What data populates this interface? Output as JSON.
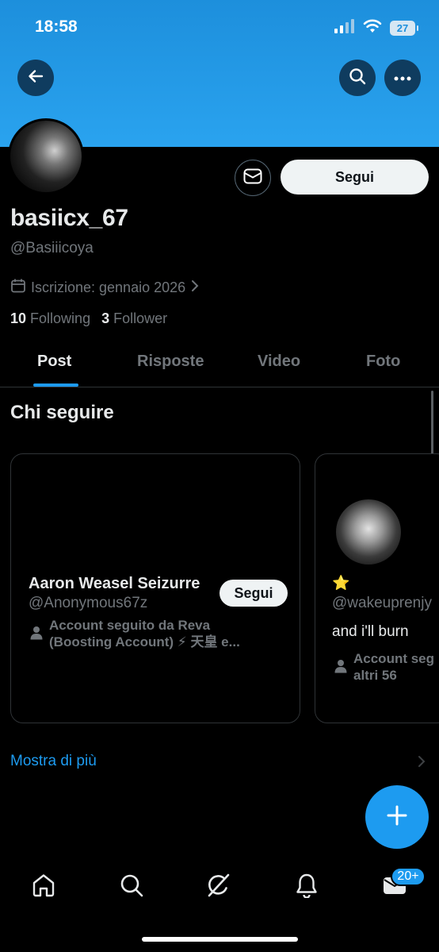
{
  "status_bar": {
    "time": "18:58",
    "battery": "27"
  },
  "header": {
    "back_icon": "arrow-left-icon",
    "search_icon": "search-icon",
    "more_icon": "more-horizontal-icon"
  },
  "profile": {
    "display_name": "basiicx_67",
    "handle": "@Basiiicoya",
    "joined": "Iscrizione: gennaio 2026",
    "following_count": "10",
    "following_label": "Following",
    "followers_count": "3",
    "followers_label": "Follower",
    "follow_button": "Segui",
    "message_icon": "message-icon"
  },
  "tabs": [
    {
      "label": "Post",
      "active": true
    },
    {
      "label": "Risposte",
      "active": false
    },
    {
      "label": "Video",
      "active": false
    },
    {
      "label": "Foto",
      "active": false
    }
  ],
  "who_to_follow": {
    "title": "Chi seguire",
    "cards": [
      {
        "name": "Aaron Weasel Seizurre",
        "handle": "@Anonymous67z",
        "follow_button": "Segui",
        "social_line1": "Account seguito da Reva",
        "social_line2": "(Boosting Account) ⚡ 天皇 e..."
      },
      {
        "name": "⭐",
        "handle": "@wakeuprenjy",
        "bio": "and i'll burn",
        "social_line1": "Account seg",
        "social_line2": "altri 56"
      }
    ],
    "show_more": "Mostra di più"
  },
  "bottom_nav": {
    "items": [
      "home-icon",
      "search-icon",
      "grok-icon",
      "notifications-icon",
      "messages-icon"
    ],
    "messages_badge": "20+"
  },
  "colors": {
    "accent": "#1d9bf0",
    "banner": "#2aa3ef",
    "muted": "#71767b",
    "background": "#000000"
  }
}
